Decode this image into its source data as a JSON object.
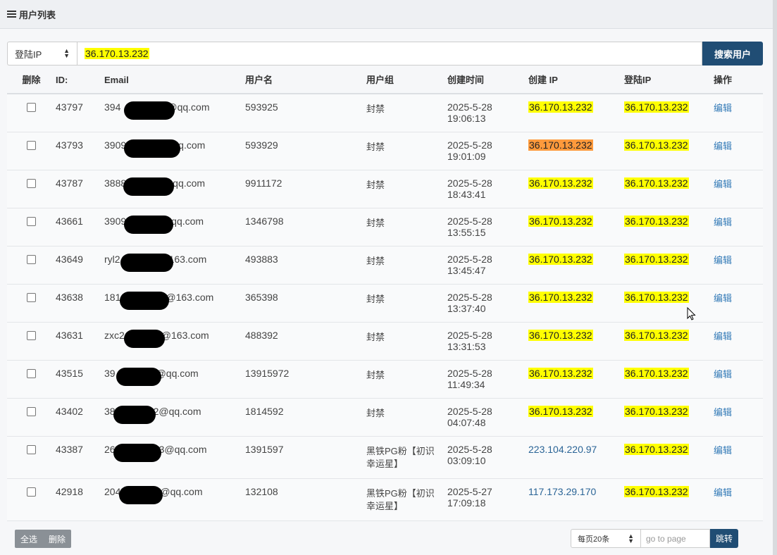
{
  "panel": {
    "title": "用户列表",
    "icon": "list-icon"
  },
  "search": {
    "field_selected": "登陆IP",
    "value": "36.170.13.232",
    "button_label": "搜索用户"
  },
  "table": {
    "headers": {
      "del": "删除",
      "id": "ID:",
      "email": "Email",
      "username": "用户名",
      "group": "用户组",
      "created": "创建时间",
      "create_ip": "创建 IP",
      "login_ip": "登陆IP",
      "op": "操作"
    },
    "rows": [
      {
        "id": "43797",
        "email_prefix": "394",
        "email_suffix": "@qq.com",
        "username": "593925",
        "group": "封禁",
        "date": "2025-5-28",
        "time": "19:06:13",
        "create_ip": "36.170.13.232",
        "create_ip_style": "hl",
        "login_ip": "36.170.13.232",
        "op": "编辑"
      },
      {
        "id": "43793",
        "email_prefix": "3909",
        "email_suffix": "q.com",
        "username": "593929",
        "group": "封禁",
        "date": "2025-5-28",
        "time": "19:01:09",
        "create_ip": "36.170.13.232",
        "create_ip_style": "org",
        "login_ip": "36.170.13.232",
        "op": "编辑"
      },
      {
        "id": "43787",
        "email_prefix": "3888",
        "email_suffix": "qq.com",
        "username": "9911172",
        "group": "封禁",
        "date": "2025-5-28",
        "time": "18:43:41",
        "create_ip": "36.170.13.232",
        "create_ip_style": "hl",
        "login_ip": "36.170.13.232",
        "op": "编辑"
      },
      {
        "id": "43661",
        "email_prefix": "3909",
        "email_suffix": "qq.com",
        "username": "1346798",
        "group": "封禁",
        "date": "2025-5-28",
        "time": "13:55:15",
        "create_ip": "36.170.13.232",
        "create_ip_style": "hl",
        "login_ip": "36.170.13.232",
        "op": "编辑"
      },
      {
        "id": "43649",
        "email_prefix": "ryl2",
        "email_suffix": "163.com",
        "username": "493883",
        "group": "封禁",
        "date": "2025-5-28",
        "time": "13:45:47",
        "create_ip": "36.170.13.232",
        "create_ip_style": "hl",
        "login_ip": "36.170.13.232",
        "op": "编辑"
      },
      {
        "id": "43638",
        "email_prefix": "181",
        "email_suffix": "@163.com",
        "username": "365398",
        "group": "封禁",
        "date": "2025-5-28",
        "time": "13:37:40",
        "create_ip": "36.170.13.232",
        "create_ip_style": "hl",
        "login_ip": "36.170.13.232",
        "op": "编辑"
      },
      {
        "id": "43631",
        "email_prefix": "zxc2",
        "email_suffix": "@163.com",
        "username": "488392",
        "group": "封禁",
        "date": "2025-5-28",
        "time": "13:31:53",
        "create_ip": "36.170.13.232",
        "create_ip_style": "hl",
        "login_ip": "36.170.13.232",
        "op": "编辑"
      },
      {
        "id": "43515",
        "email_prefix": "39",
        "email_suffix": "@qq.com",
        "username": "13915972",
        "group": "封禁",
        "date": "2025-5-28",
        "time": "11:49:34",
        "create_ip": "36.170.13.232",
        "create_ip_style": "hl",
        "login_ip": "36.170.13.232",
        "op": "编辑"
      },
      {
        "id": "43402",
        "email_prefix": "38",
        "email_suffix": "2@qq.com",
        "username": "1814592",
        "group": "封禁",
        "date": "2025-5-28",
        "time": "04:07:48",
        "create_ip": "36.170.13.232",
        "create_ip_style": "hl",
        "login_ip": "36.170.13.232",
        "op": "编辑"
      },
      {
        "id": "43387",
        "email_prefix": "26",
        "email_suffix": "3@qq.com",
        "username": "1391597",
        "group": "黑铁PG粉【初识幸运星】",
        "date": "2025-5-28",
        "time": "03:09:10",
        "create_ip": "223.104.220.97",
        "create_ip_style": "plain",
        "login_ip": "36.170.13.232",
        "op": "编辑"
      },
      {
        "id": "42918",
        "email_prefix": "204",
        "email_suffix": "@qq.com",
        "username": "132108",
        "group": "黑铁PG粉【初识幸运星】",
        "date": "2025-5-27",
        "time": "17:09:18",
        "create_ip": "117.173.29.170",
        "create_ip_style": "plain",
        "login_ip": "36.170.13.232",
        "op": "编辑"
      }
    ]
  },
  "footer": {
    "select_all": "全选",
    "delete": "删除",
    "per_page": "每页20条",
    "goto_placeholder": "go to page",
    "jump": "跳转"
  },
  "colors": {
    "search_highlight": "#ffff00",
    "orange_highlight": "#ff9a3c",
    "primary": "#204d74",
    "link": "#337ab7"
  }
}
